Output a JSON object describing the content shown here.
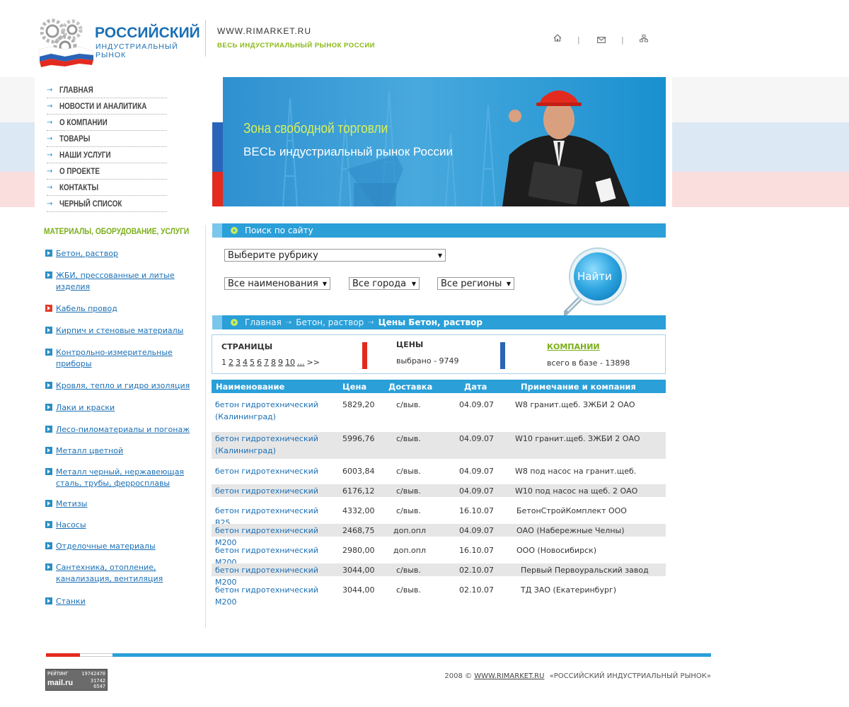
{
  "header": {
    "logo_title": "РОССИЙСКИЙ",
    "logo_sub": "ИНДУСТРИАЛЬНЫЙ РЫНОК",
    "site_url": "WWW.RIMARKET.RU",
    "site_tagline": "ВЕСЬ ИНДУСТРИАЛЬНЫЙ РЫНОК РОССИИ",
    "icons": [
      "home-icon",
      "mail-icon",
      "sitemap-icon"
    ]
  },
  "top_menu": [
    "ГЛАВНАЯ",
    "НОВОСТИ И АНАЛИТИКА",
    "О КОМПАНИИ",
    "ТОВАРЫ",
    "НАШИ УСЛУГИ",
    "О ПРОЕКТЕ",
    "КОНТАКТЫ",
    "ЧЕРНЫЙ СПИСОК"
  ],
  "banner": {
    "heading": "Зона свободной торговли",
    "subheading": "ВЕСЬ индустриальный рынок России"
  },
  "categories": {
    "heading": "МАТЕРИАЛЫ, ОБОРУДОВАНИЕ, УСЛУГИ",
    "items": [
      {
        "label": "Бетон, раствор",
        "active": false
      },
      {
        "label": "ЖБИ, прессованные и литые изделия",
        "active": false
      },
      {
        "label": "Кабель провод",
        "active": true
      },
      {
        "label": "Кирпич и стеновые материалы",
        "active": false
      },
      {
        "label": "Контрольно-измерительные приборы",
        "active": false
      },
      {
        "label": "Кровля, тепло и гидро изоляция",
        "active": false
      },
      {
        "label": "Лаки и краски",
        "active": false
      },
      {
        "label": "Лесо-пиломатериалы и погонаж",
        "active": false
      },
      {
        "label": "Металл цветной",
        "active": false
      },
      {
        "label": "Металл черный, нержавеющая сталь, трубы, ферросплавы",
        "active": false
      },
      {
        "label": "Метизы",
        "active": false
      },
      {
        "label": "Насосы",
        "active": false
      },
      {
        "label": "Отделочные материалы",
        "active": false
      },
      {
        "label": "Сантехника, отопление, канализация, вентиляция",
        "active": false
      },
      {
        "label": "Станки",
        "active": false
      }
    ]
  },
  "search": {
    "title": "Поиск по сайту",
    "rubric": "Выберите рубрику",
    "names": "Все наименования",
    "cities": "Все города",
    "regions": "Все регионы",
    "find_label": "Найти"
  },
  "breadcrumb": {
    "items": [
      "Главная",
      "Бетон, раствор"
    ],
    "current": "Цены  Бетон, раствор"
  },
  "stats": {
    "pages_label": "СТРАНИЦЫ",
    "pages": [
      "1",
      "2",
      "3",
      "4",
      "5",
      "6",
      "7",
      "8",
      "9",
      "10",
      "...",
      ">>"
    ],
    "prices_label": "ЦЕНЫ",
    "prices_text": "выбрано - 9749",
    "companies_label": "КОМПАНИИ",
    "companies_text": "всего в базе -  13898"
  },
  "table": {
    "headers": [
      "Наименование",
      "Цена",
      "Доставка",
      "Дата",
      "Примечание и компания"
    ],
    "rows": [
      {
        "name": "бетон гидротехнический (Калининград)",
        "price": "5829,20",
        "delivery": "с/выв.",
        "date": "04.09.07",
        "note": "W8 гранит.щеб. ЗЖБИ 2 ОАО"
      },
      {
        "name": "бетон гидротехнический (Калининград)",
        "price": "5996,76",
        "delivery": "с/выв.",
        "date": "04.09.07",
        "note": "W10 гранит.щеб. ЗЖБИ 2 ОАО"
      },
      {
        "name": "бетон гидротехнический",
        "price": "6003,84",
        "delivery": "с/выв.",
        "date": "04.09.07",
        "note": "W8 под насос на гранит.щеб."
      },
      {
        "name": "бетон гидротехнический",
        "price": "6176,12",
        "delivery": "с/выв.",
        "date": "04.09.07",
        "note": "W10 под насос на щеб. 2 ОАО"
      },
      {
        "name": "бетон гидротехнический В25",
        "price": "4332,00",
        "delivery": "с/выв.",
        "date": "16.10.07",
        "note": "БетонСтройКомплект ООО"
      },
      {
        "name": "бетон гидротехнический М200",
        "price": "2468,75",
        "delivery": "доп.опл",
        "date": "04.09.07",
        "note": "ОАО (Набережные Челны)"
      },
      {
        "name": "бетон гидротехнический М200",
        "price": "2980,00",
        "delivery": "доп.опл",
        "date": "16.10.07",
        "note": "ООО (Новосибирск)"
      },
      {
        "name": "бетон гидротехнический М200",
        "price": "3044,00",
        "delivery": "с/выв.",
        "date": "02.10.07",
        "note": "Первый Первоуральский завод"
      },
      {
        "name": "бетон гидротехнический М200",
        "price": "3044,00",
        "delivery": "с/выв.",
        "date": "02.10.07",
        "note": "ТД ЗАО (Екатеринбург)"
      }
    ]
  },
  "footer": {
    "copyright_prefix": "2008 ©",
    "link": "WWW.RIMARKET.RU",
    "suffix": "«РОССИЙСКИЙ ИНДУСТРИАЛЬНЫЙ РЫНОК»",
    "counter_label": "РЕЙТИНГ",
    "counter_brand": "mail.ru",
    "counter_values": [
      "19742470",
      "31742",
      "6547"
    ]
  }
}
